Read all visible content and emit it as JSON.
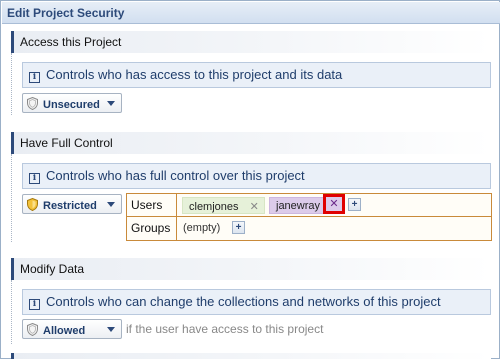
{
  "dialog": {
    "title": "Edit Project Security"
  },
  "sections": [
    {
      "header": "Access this Project",
      "info": "Controls who has access to this project and its data",
      "dropdown": {
        "value": "Unsecured",
        "icon": "shield-gray-icon"
      }
    },
    {
      "header": "Have Full Control",
      "info": "Controls who has full control over this project",
      "dropdown": {
        "value": "Restricted",
        "icon": "shield-gold-icon"
      },
      "users_label": "Users",
      "users": [
        {
          "name": "clemjones",
          "remove": "✕"
        },
        {
          "name": "janewray",
          "remove": "✕"
        }
      ],
      "groups_label": "Groups",
      "groups_value": "(empty)",
      "add_symbol": "+"
    },
    {
      "header": "Modify Data",
      "info": "Controls who can change the collections and networks of this project",
      "dropdown": {
        "value": "Allowed",
        "icon": "shield-gray-icon"
      },
      "hint": "if the user have access to this project"
    }
  ],
  "colors": {
    "accent": "#2d4a7a",
    "highlight": "#e00000",
    "user_chip_green": "#e6f1d9",
    "user_chip_purple": "#dccbea",
    "table_border": "#c98a3a"
  }
}
